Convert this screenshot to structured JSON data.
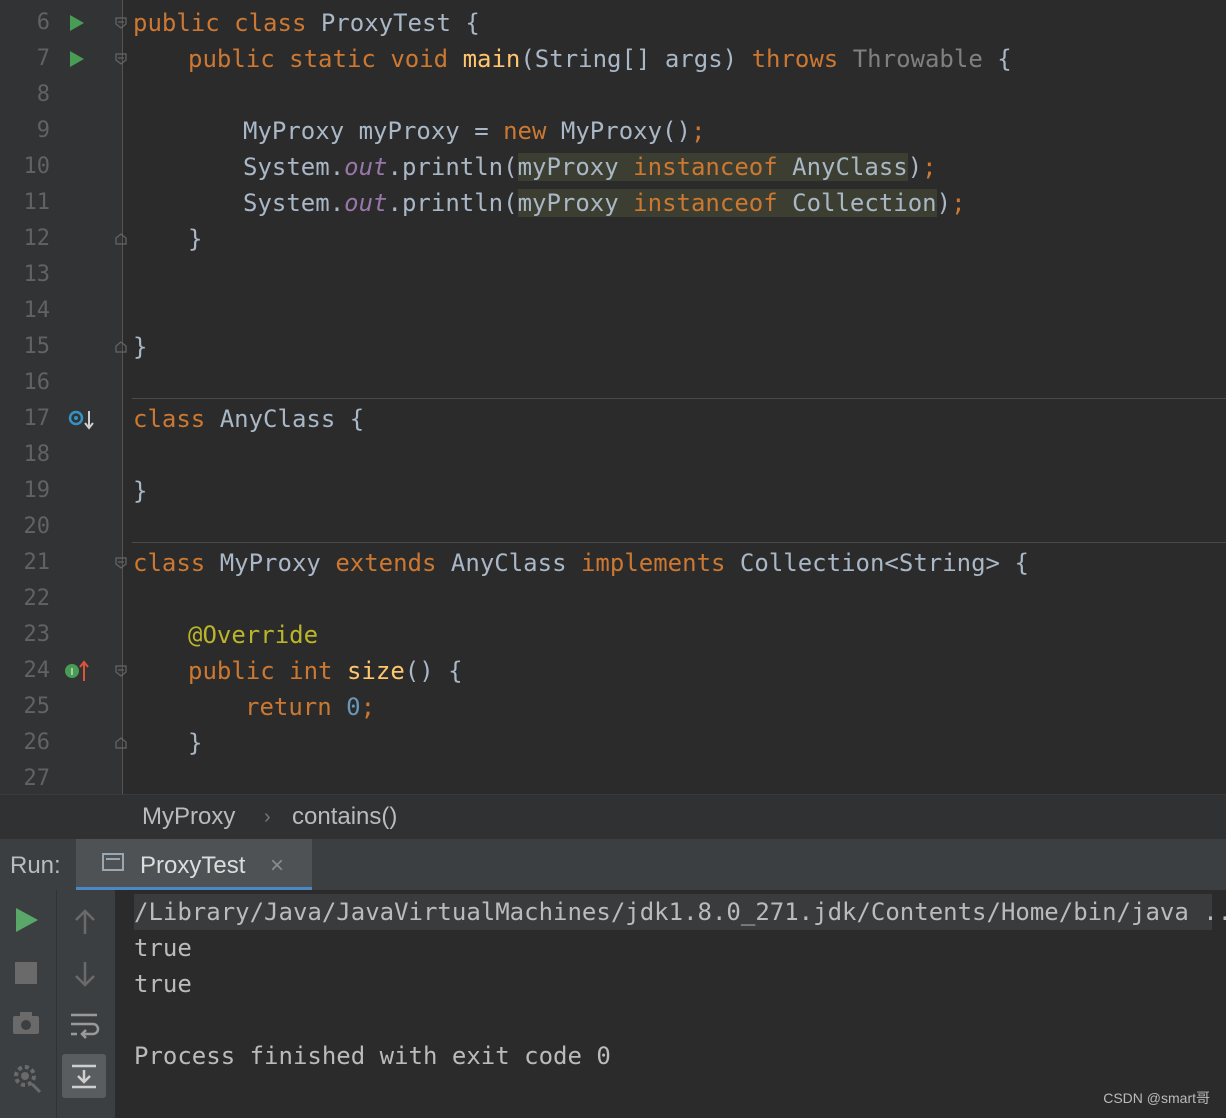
{
  "editor": {
    "line_numbers": [
      "6",
      "7",
      "8",
      "9",
      "10",
      "11",
      "12",
      "13",
      "14",
      "15",
      "16",
      "17",
      "18",
      "19",
      "20",
      "21",
      "22",
      "23",
      "24",
      "25",
      "26",
      "27"
    ],
    "tokens": {
      "public": "public",
      "class": "class",
      "static": "static",
      "void": "void",
      "throws": "throws",
      "new": "new",
      "instanceof": "instanceof",
      "extends": "extends",
      "implements": "implements",
      "int": "int",
      "return": "return",
      "ProxyTest": "ProxyTest",
      "main": "main",
      "main_args": "(String[] args)",
      "Throwable": "Throwable",
      "open_brace": "{",
      "close_brace": "}",
      "MyProxy": "MyProxy",
      "myProxy_decl": "MyProxy myProxy = ",
      "MyProxy_ctor": "MyProxy()",
      "semicolon": ";",
      "System_dot": "System.",
      "out": "out",
      "println_open": ".println(",
      "myProxy": "myProxy",
      "AnyClass": "AnyClass",
      "Collection": "Collection",
      "paren_close": ")",
      "Collection_generic": "Collection<String>",
      "Override": "@Override",
      "size": "size",
      "empty_parens": "()",
      "zero": "0"
    }
  },
  "breadcrumb": {
    "class_name": "MyProxy",
    "separator": "›",
    "method": "contains()"
  },
  "run_panel": {
    "label": "Run:",
    "tab_label": "ProxyTest",
    "tab_close": "×",
    "output": [
      "/Library/Java/JavaVirtualMachines/jdk1.8.0_271.jdk/Contents/Home/bin/java ...",
      "true",
      "true",
      "",
      "Process finished with exit code 0"
    ]
  },
  "watermark": "CSDN @smart哥",
  "colors": {
    "keyword": "#cc7832",
    "function": "#ffc66d",
    "static_field": "#9876aa",
    "annotation": "#bbb529",
    "number": "#6897bb",
    "run_green": "#59a869"
  }
}
